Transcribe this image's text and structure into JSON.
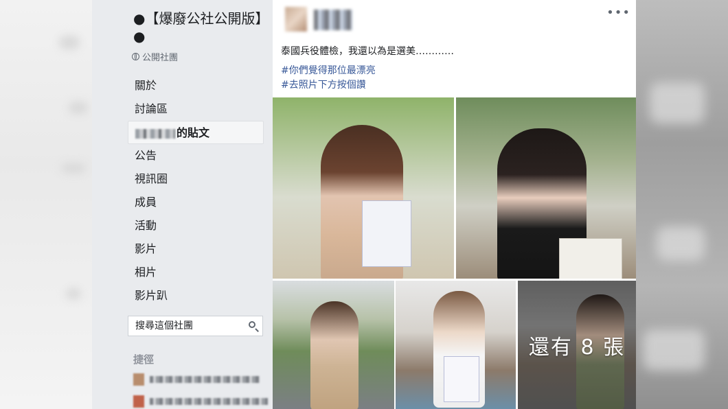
{
  "group": {
    "title": "●【爆廢公社公開版】●",
    "type": "公開社團"
  },
  "nav": {
    "items": [
      {
        "label": "關於"
      },
      {
        "label": "討論區"
      },
      {
        "label": "的貼文"
      },
      {
        "label": "公告"
      },
      {
        "label": "視訊圈"
      },
      {
        "label": "成員"
      },
      {
        "label": "活動"
      },
      {
        "label": "影片"
      },
      {
        "label": "相片"
      },
      {
        "label": "影片趴"
      }
    ],
    "search_placeholder": "搜尋這個社團",
    "shortcuts_title": "捷徑"
  },
  "post": {
    "text": "泰國兵役體檢，我還以為是選美…………",
    "hashtags": [
      "#你們覺得那位最漂亮",
      "#去照片下方按個讚"
    ],
    "more_photos_label": "還有 8 張"
  },
  "colors": {
    "nav_background": "#e9ebee",
    "link": "#385898"
  }
}
